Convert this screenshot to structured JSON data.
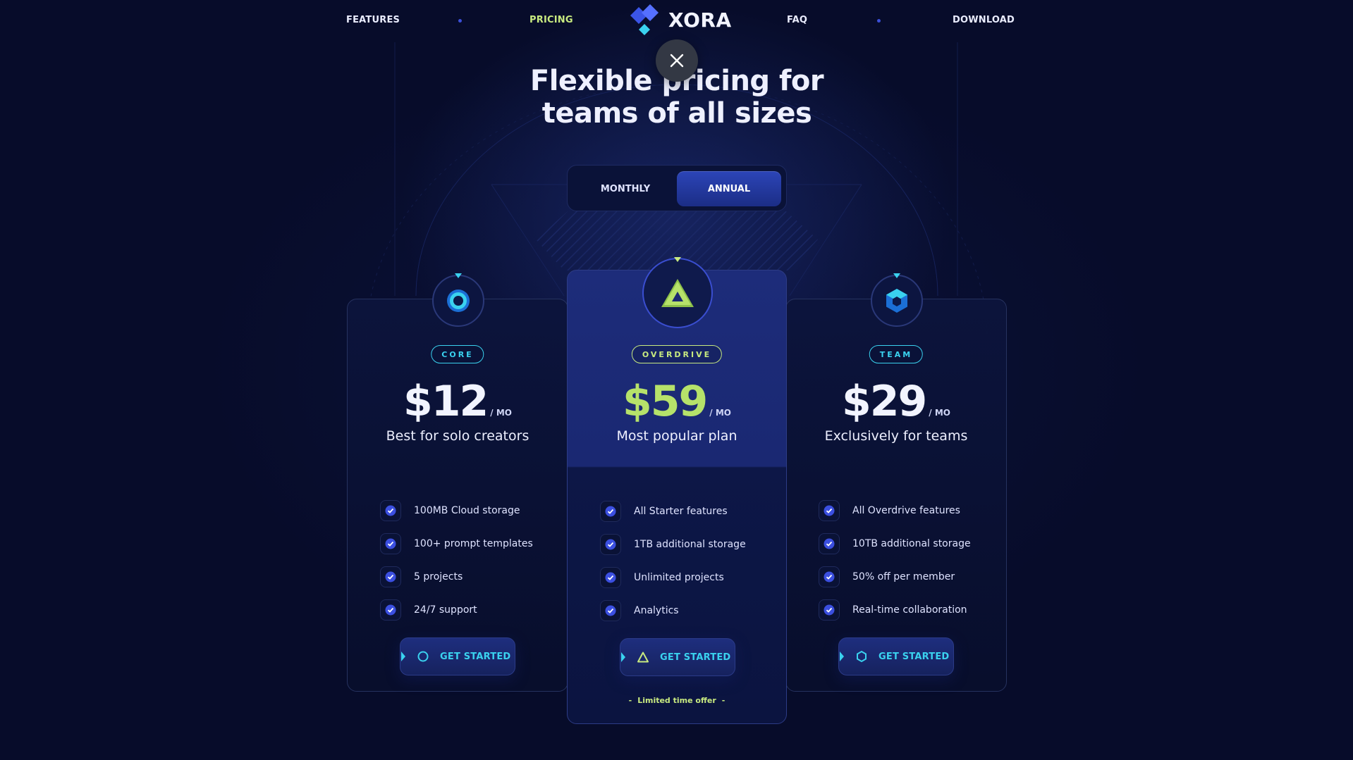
{
  "nav": {
    "links": [
      "FEATURES",
      "PRICING",
      "FAQ",
      "DOWNLOAD"
    ],
    "active": "PRICING",
    "logo_text": "XORA"
  },
  "hero": {
    "headline_line1": "Flexible pricing for",
    "headline_line2": "teams of all sizes"
  },
  "billing_toggle": {
    "options": [
      "MONTHLY",
      "ANNUAL"
    ],
    "selected": "ANNUAL"
  },
  "plans": [
    {
      "badge": "CORE",
      "price": "$12",
      "unit": "/ MO",
      "description": "Best for solo creators",
      "features": [
        "100MB Cloud storage",
        "100+ prompt templates",
        "5 projects",
        "24/7 support"
      ],
      "cta": "GET STARTED",
      "icon": "circle-core-icon"
    },
    {
      "badge": "OVERDRIVE",
      "price": "$59",
      "unit": "/ MO",
      "description": "Most popular plan",
      "features": [
        "All Starter features",
        "1TB additional storage",
        "Unlimited projects",
        "Analytics"
      ],
      "cta": "GET STARTED",
      "offer": "Limited time offer",
      "icon": "triangle-overdrive-icon"
    },
    {
      "badge": "TEAM",
      "price": "$29",
      "unit": "/ MO",
      "description": "Exclusively for teams",
      "features": [
        "All Overdrive features",
        "10TB additional storage",
        "50% off per member",
        "Real-time collaboration"
      ],
      "cta": "GET STARTED",
      "icon": "hexagon-team-icon"
    }
  ],
  "colors": {
    "background": "#070c2a",
    "accent_cyan": "#3ad2ef",
    "accent_lime": "#b6e26a",
    "primary_blue": "#2c45b8"
  }
}
